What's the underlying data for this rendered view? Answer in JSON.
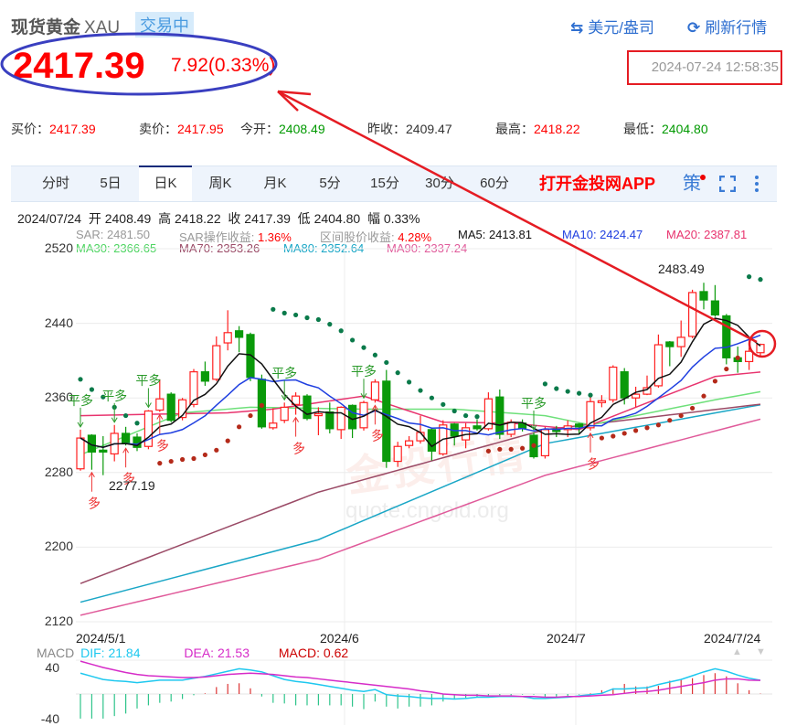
{
  "header": {
    "title": "现货黄金",
    "code": "XAU",
    "status_badge": "交易中",
    "unit_toggle": "美元/盎司",
    "refresh": "刷新行情"
  },
  "quote": {
    "price": "2417.39",
    "change": "7.92(0.33%)",
    "timestamp": "2024-07-24 12:58:35"
  },
  "stats": [
    {
      "label": "买价：",
      "value": "2417.39",
      "tone": "red"
    },
    {
      "label": "卖价：",
      "value": "2417.95",
      "tone": "red"
    },
    {
      "label": "今开：",
      "value": "2408.49",
      "tone": "green"
    },
    {
      "label": "昨收：",
      "value": "2409.47",
      "tone": "plain"
    },
    {
      "label": "最高：",
      "value": "2418.22",
      "tone": "red"
    },
    {
      "label": "最低：",
      "value": "2404.80",
      "tone": "green"
    }
  ],
  "tabs": [
    "分时",
    "5日",
    "日K",
    "周K",
    "月K",
    "5分",
    "15分",
    "30分",
    "60分"
  ],
  "active_tab": "日K",
  "app_link": "打开金投网APP",
  "strategy_icon": "策",
  "ohlc_line": "2024/07/24  开 2408.49  高 2418.22  收 2417.39  低 2404.80  幅 0.33%",
  "indicators": {
    "sar": "SAR: 2481.50",
    "sar_gain_label": "SAR操作收益:",
    "sar_gain": "1.36%",
    "range_gain_label": "区间股价收益:",
    "range_gain": "4.28%",
    "ma5": "MA5: 2413.81",
    "ma10": "MA10: 2424.47",
    "ma20": "MA20: 2387.81",
    "ma30": "MA30: 2366.65",
    "ma70": "MA70: 2353.26",
    "ma80": "MA80: 2352.64",
    "ma90": "MA90: 2337.24"
  },
  "macd_legend": {
    "name": "MACD",
    "dif": "DIF: 21.84",
    "dea": "DEA: 21.53",
    "macd": "MACD: 0.62"
  },
  "watermark": {
    "brand": "金投行情",
    "url": "quote.cngold.org"
  },
  "colors": {
    "up": "#ff2020",
    "down": "#0a9a0a",
    "ma5": "#111111",
    "ma10": "#1f3fe0",
    "ma20": "#e8336e",
    "ma30": "#6ee07a",
    "ma70": "#9a4a66",
    "ma80": "#19a6c6",
    "ma90": "#e05a9a",
    "dif": "#1ec8ef",
    "dea": "#d62cc8",
    "sar_up": "#0a7a4a",
    "sar_down": "#b42a1a"
  },
  "chart_data": {
    "type": "candlestick",
    "title": "XAU daily K",
    "ylim": [
      2120,
      2520
    ],
    "yticks": [
      "2520",
      "2440",
      "2360",
      "2280",
      "2200",
      "2120"
    ],
    "xticks": [
      {
        "label": "2024/5/1",
        "candle": 1
      },
      {
        "label": "2024/6",
        "candle": 23
      },
      {
        "label": "2024/7",
        "candle": 44
      },
      {
        "label": "2024/7/24",
        "candle": 61
      }
    ],
    "ohlc": [
      [
        2284,
        2326,
        2282,
        2317
      ],
      [
        2320,
        2321,
        2283,
        2302
      ],
      [
        2304,
        2319,
        2277.19,
        2302
      ],
      [
        2300,
        2331,
        2292,
        2322
      ],
      [
        2322,
        2329,
        2309,
        2312
      ],
      [
        2318,
        2322,
        2303,
        2307
      ],
      [
        2308,
        2347,
        2305,
        2346
      ],
      [
        2347,
        2380,
        2345,
        2359
      ],
      [
        2364,
        2366,
        2334,
        2336
      ],
      [
        2339,
        2360,
        2336,
        2358
      ],
      [
        2353,
        2391,
        2350,
        2388
      ],
      [
        2388,
        2399,
        2373,
        2378
      ],
      [
        2380,
        2426,
        2378,
        2416
      ],
      [
        2419,
        2454,
        2411,
        2430
      ],
      [
        2432,
        2437,
        2409,
        2425
      ],
      [
        2428,
        2430,
        2378,
        2382
      ],
      [
        2380,
        2385,
        2327,
        2329
      ],
      [
        2328,
        2349,
        2326,
        2333
      ],
      [
        2336,
        2355,
        2333,
        2350
      ],
      [
        2353,
        2366,
        2342,
        2362
      ],
      [
        2362,
        2364,
        2336,
        2338
      ],
      [
        2341,
        2350,
        2320,
        2343
      ],
      [
        2345,
        2355,
        2322,
        2327
      ],
      [
        2326,
        2351,
        2316,
        2350
      ],
      [
        2352,
        2353,
        2317,
        2327
      ],
      [
        2328,
        2357,
        2325,
        2355
      ],
      [
        2358,
        2380,
        2355,
        2377
      ],
      [
        2378,
        2390,
        2285,
        2292
      ],
      [
        2292,
        2313,
        2286,
        2308
      ],
      [
        2309,
        2319,
        2306,
        2314
      ],
      [
        2314,
        2341,
        2311,
        2323
      ],
      [
        2326,
        2328,
        2293,
        2303
      ],
      [
        2300,
        2336,
        2298,
        2331
      ],
      [
        2332,
        2333,
        2309,
        2319
      ],
      [
        2315,
        2333,
        2306,
        2328
      ],
      [
        2330,
        2337,
        2325,
        2327
      ],
      [
        2327,
        2366,
        2325,
        2359
      ],
      [
        2361,
        2369,
        2316,
        2321
      ],
      [
        2321,
        2337,
        2318,
        2334
      ],
      [
        2333,
        2337,
        2324,
        2327
      ],
      [
        2320,
        2323,
        2295,
        2297
      ],
      [
        2298,
        2329,
        2295,
        2326
      ],
      [
        2326,
        2330,
        2318,
        2324
      ],
      [
        2326,
        2336,
        2318,
        2330
      ],
      [
        2332,
        2333,
        2322,
        2329
      ],
      [
        2328,
        2361,
        2325,
        2356
      ],
      [
        2355,
        2363,
        2350,
        2357
      ],
      [
        2358,
        2395,
        2355,
        2393
      ],
      [
        2388,
        2392,
        2353,
        2360
      ],
      [
        2360,
        2372,
        2350,
        2364
      ],
      [
        2364,
        2384,
        2363,
        2371
      ],
      [
        2373,
        2428,
        2371,
        2417
      ],
      [
        2420,
        2421,
        2394,
        2415
      ],
      [
        2415,
        2443,
        2404,
        2425
      ],
      [
        2426,
        2476,
        2424,
        2473
      ],
      [
        2474,
        2483.49,
        2455,
        2465
      ],
      [
        2464,
        2481,
        2447,
        2449
      ],
      [
        2448,
        2450,
        2396,
        2403
      ],
      [
        2403,
        2415,
        2387,
        2399
      ],
      [
        2399,
        2414,
        2390,
        2410
      ],
      [
        2408.49,
        2418.22,
        2404.8,
        2417.39
      ]
    ],
    "annotations": {
      "high_label": "2483.49",
      "high_candle": 56,
      "low_label": "2277.19",
      "low_candle": 3
    },
    "sar": [
      2380,
      2369,
      2361,
      2350,
      2341,
      2333,
      null,
      2290,
      2292,
      2294,
      2295,
      2299,
      2304,
      2314,
      2329,
      2341,
      2352,
      2455,
      2451,
      2449,
      2446,
      2444,
      2439,
      2432,
      2422,
      2414,
      2406,
      2398,
      2387,
      2377,
      2368,
      2360,
      2353,
      2346,
      2341,
      2340,
      2303,
      2305,
      2305,
      2306,
      2309,
      2375,
      2370,
      2367,
      2365,
      2363,
      2317,
      2319,
      2322,
      2325,
      2328,
      2331,
      2336,
      2341,
      2349,
      2362,
      2378,
      2391,
      2403,
      2490,
      2487
    ],
    "signals": [
      {
        "candle": 1,
        "label": "平多",
        "kind": "close"
      },
      {
        "candle": 2,
        "label": "多",
        "kind": "long"
      },
      {
        "candle": 4,
        "label": "平多",
        "kind": "close"
      },
      {
        "candle": 5,
        "label": "多",
        "kind": "long"
      },
      {
        "candle": 7,
        "label": "平多",
        "kind": "close"
      },
      {
        "candle": 8,
        "label": "多",
        "kind": "long"
      },
      {
        "candle": 19,
        "label": "平多",
        "kind": "close"
      },
      {
        "candle": 20,
        "label": "多",
        "kind": "long"
      },
      {
        "candle": 26,
        "label": "平多",
        "kind": "close"
      },
      {
        "candle": 27,
        "label": "多",
        "kind": "long"
      },
      {
        "candle": 41,
        "label": "平多",
        "kind": "close"
      },
      {
        "candle": 46,
        "label": "多",
        "kind": "long"
      }
    ],
    "ma_anchor_series": {
      "ma20": [
        [
          1,
          2341
        ],
        [
          14,
          2344
        ],
        [
          18,
          2348
        ],
        [
          26,
          2362
        ],
        [
          33,
          2334
        ],
        [
          39,
          2333
        ],
        [
          45,
          2326
        ],
        [
          50,
          2350
        ],
        [
          57,
          2383
        ],
        [
          61,
          2387.81
        ]
      ],
      "ma30": [
        [
          1,
          2299
        ],
        [
          10,
          2344
        ],
        [
          16,
          2350
        ],
        [
          26,
          2348
        ],
        [
          34,
          2348
        ],
        [
          42,
          2341
        ],
        [
          46,
          2331
        ],
        [
          50,
          2341
        ],
        [
          57,
          2358
        ],
        [
          61,
          2366.65
        ]
      ],
      "ma70": [
        [
          1,
          2161
        ],
        [
          22,
          2259
        ],
        [
          42,
          2326
        ],
        [
          61,
          2353.26
        ]
      ],
      "ma80": [
        [
          1,
          2141
        ],
        [
          22,
          2208
        ],
        [
          42,
          2311
        ],
        [
          61,
          2352.64
        ]
      ],
      "ma90": [
        [
          1,
          2127
        ],
        [
          22,
          2187
        ],
        [
          42,
          2277
        ],
        [
          61,
          2337.24
        ]
      ]
    },
    "macd": {
      "ylim": [
        -40,
        40
      ],
      "yticks": [
        "40",
        "-40"
      ],
      "dif": [
        33,
        28,
        23,
        21,
        20,
        18,
        20,
        22,
        22,
        22,
        25,
        28,
        32,
        36,
        40,
        38,
        35,
        29,
        23,
        20,
        18,
        15,
        12,
        9,
        6,
        4,
        7,
        -1,
        -3,
        -4,
        -6,
        -7,
        -7,
        -8,
        -7,
        -5,
        -5,
        -4,
        -4,
        -4,
        -7,
        -7,
        -6,
        -5,
        -3,
        -1,
        1,
        8,
        8,
        9,
        10,
        15,
        19,
        23,
        29,
        35,
        40,
        36,
        30,
        25,
        21.84
      ],
      "dea": [
        52,
        47,
        42,
        38,
        34,
        31,
        29,
        28,
        27,
        26,
        26,
        27,
        29,
        31,
        32,
        33,
        32,
        31,
        29,
        27,
        26,
        24,
        22,
        20,
        18,
        16,
        14,
        12,
        10,
        8,
        5,
        3,
        0,
        -1,
        -2,
        -2,
        -3,
        -3,
        -3,
        -4,
        -4,
        -5,
        -5,
        -4,
        -4,
        -3,
        -2,
        -1,
        1,
        3,
        4,
        6,
        9,
        12,
        15,
        18,
        22,
        24,
        24,
        22,
        21.53
      ],
      "hist": [
        -39,
        -39,
        -39,
        -35,
        -31,
        -23,
        -18,
        -14,
        -12,
        -8,
        -2,
        1,
        11,
        16,
        17,
        9,
        -4,
        -14,
        -15,
        -18,
        -18,
        -18,
        -18,
        -18,
        -20,
        -24,
        -12,
        -20,
        -23,
        -20,
        -20,
        -18,
        -12,
        -8,
        -6,
        -5,
        -3,
        -2,
        -2,
        -1,
        -1,
        -5,
        -5,
        -3,
        -1,
        1,
        6,
        9,
        16,
        12,
        12,
        13,
        21,
        23,
        25,
        30,
        33,
        28,
        17,
        6,
        0.62
      ]
    }
  }
}
